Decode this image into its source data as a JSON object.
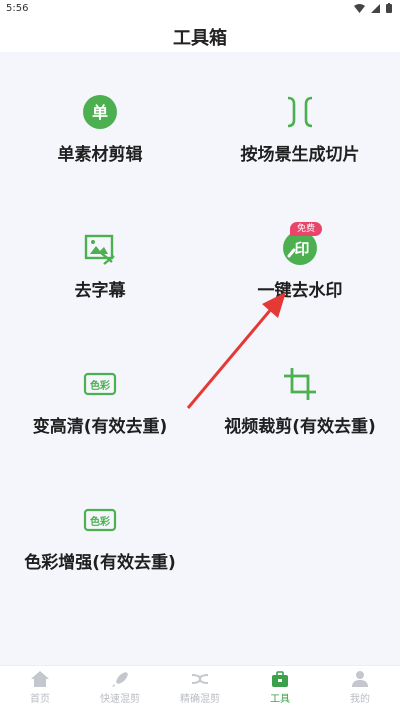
{
  "statusbar": {
    "time": "5:56"
  },
  "header": {
    "title": "工具箱"
  },
  "tools": [
    {
      "label": "单素材剪辑",
      "icon": "single-clip-icon",
      "glyph": "单"
    },
    {
      "label": "按场景生成切片",
      "icon": "scene-split-icon"
    },
    {
      "label": "去字幕",
      "icon": "remove-subtitle-icon"
    },
    {
      "label": "一键去水印",
      "icon": "remove-watermark-icon",
      "glyph": "印",
      "badge": "免费"
    },
    {
      "label": "变高清(有效去重)",
      "icon": "hd-enhance-icon",
      "glyph": "色彩"
    },
    {
      "label": "视频裁剪(有效去重)",
      "icon": "crop-icon"
    },
    {
      "label": "色彩增强(有效去重)",
      "icon": "color-enhance-icon",
      "glyph": "色彩"
    }
  ],
  "tabbar": {
    "items": [
      {
        "label": "首页",
        "icon": "home-icon",
        "active": false
      },
      {
        "label": "快速混剪",
        "icon": "rocket-icon",
        "active": false
      },
      {
        "label": "精确混剪",
        "icon": "shuffle-icon",
        "active": false
      },
      {
        "label": "工具",
        "icon": "toolbox-icon",
        "active": true
      },
      {
        "label": "我的",
        "icon": "user-icon",
        "active": false
      }
    ]
  },
  "colors": {
    "accent": "#3aa14a",
    "arrow": "#e53935",
    "badge": "#e8456a"
  }
}
